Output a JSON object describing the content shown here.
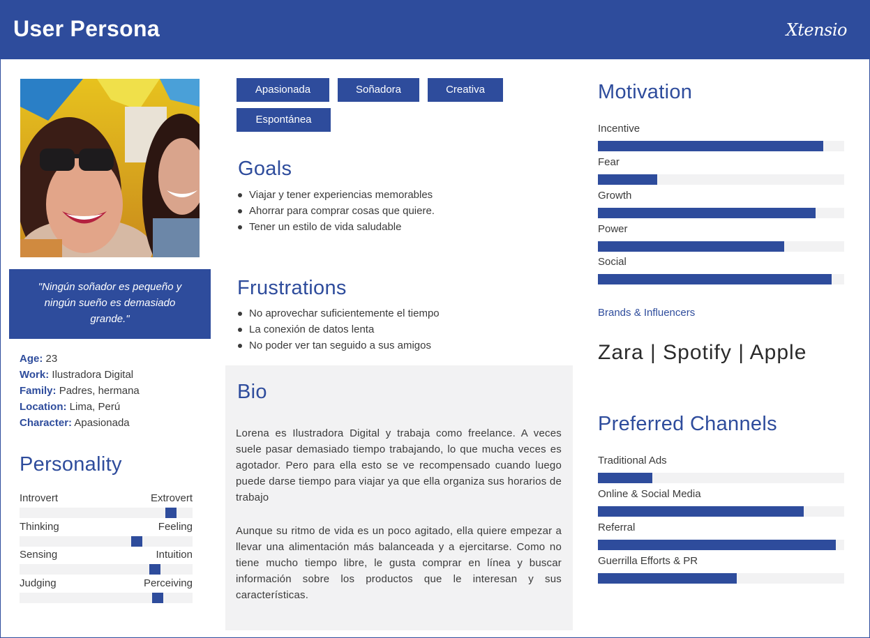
{
  "header": {
    "title": "User Persona",
    "logo": "Xtensio"
  },
  "photo": {
    "icon": "persona-photo"
  },
  "quote": "\"Ningún soñador es pequeño y ningún sueño es demasiado grande.\"",
  "facts": [
    {
      "label": "Age",
      "value": "23"
    },
    {
      "label": "Work",
      "value": "Ilustradora Digital"
    },
    {
      "label": "Family",
      "value": "Padres, hermana"
    },
    {
      "label": "Location",
      "value": "Lima, Perú"
    },
    {
      "label": "Character",
      "value": "Apasionada"
    }
  ],
  "personality": {
    "title": "Personality",
    "rows": [
      {
        "left": "Introvert",
        "right": "Extrovert",
        "value": 0.9
      },
      {
        "left": "Thinking",
        "right": "Feeling",
        "value": 0.69
      },
      {
        "left": "Sensing",
        "right": "Intuition",
        "value": 0.8
      },
      {
        "left": "Judging",
        "right": "Perceiving",
        "value": 0.82
      }
    ]
  },
  "tags": [
    "Apasionada",
    "Soñadora",
    "Creativa",
    "Espontánea"
  ],
  "goals": {
    "title": "Goals",
    "items": [
      "Viajar y tener experiencias memorables",
      "Ahorrar para comprar cosas que quiere.",
      "Tener un estilo de vida saludable"
    ]
  },
  "frustrations": {
    "title": "Frustrations",
    "items": [
      "No aprovechar suficientemente el tiempo",
      "La conexión de datos lenta",
      "No poder ver tan seguido a sus amigos"
    ]
  },
  "bio": {
    "title": "Bio",
    "paragraphs": [
      "Lorena es Ilustradora Digital y trabaja como freelance. A veces suele pasar demasiado tiempo trabajando, lo que mucha veces es agotador. Pero para ella esto se ve recompensado cuando luego puede darse tiempo para viajar ya que ella organiza sus horarios de trabajo",
      "Aunque su ritmo de vida es un poco agitado, ella quiere empezar a llevar una alimentación más balanceada y a ejercitarse. Como no tiene mucho tiempo libre, le gusta comprar en línea y buscar información sobre los productos que le interesan y sus características."
    ]
  },
  "motivation": {
    "title": "Motivation",
    "items": [
      {
        "label": "Incentive",
        "value": 0.915
      },
      {
        "label": "Fear",
        "value": 0.24
      },
      {
        "label": "Growth",
        "value": 0.885
      },
      {
        "label": "Power",
        "value": 0.755
      },
      {
        "label": "Social",
        "value": 0.95
      }
    ]
  },
  "brands": {
    "label": "Brands & Influencers",
    "text": "Zara | Spotify | Apple"
  },
  "channels": {
    "title": "Preferred Channels",
    "items": [
      {
        "label": "Traditional Ads",
        "value": 0.22
      },
      {
        "label": "Online & Social Media",
        "value": 0.835
      },
      {
        "label": "Referral",
        "value": 0.965
      },
      {
        "label": "Guerrilla Efforts & PR",
        "value": 0.565
      }
    ]
  },
  "colors": {
    "accent": "#2e4c9c",
    "track": "#f2f2f3",
    "text": "#3a3a3a"
  }
}
